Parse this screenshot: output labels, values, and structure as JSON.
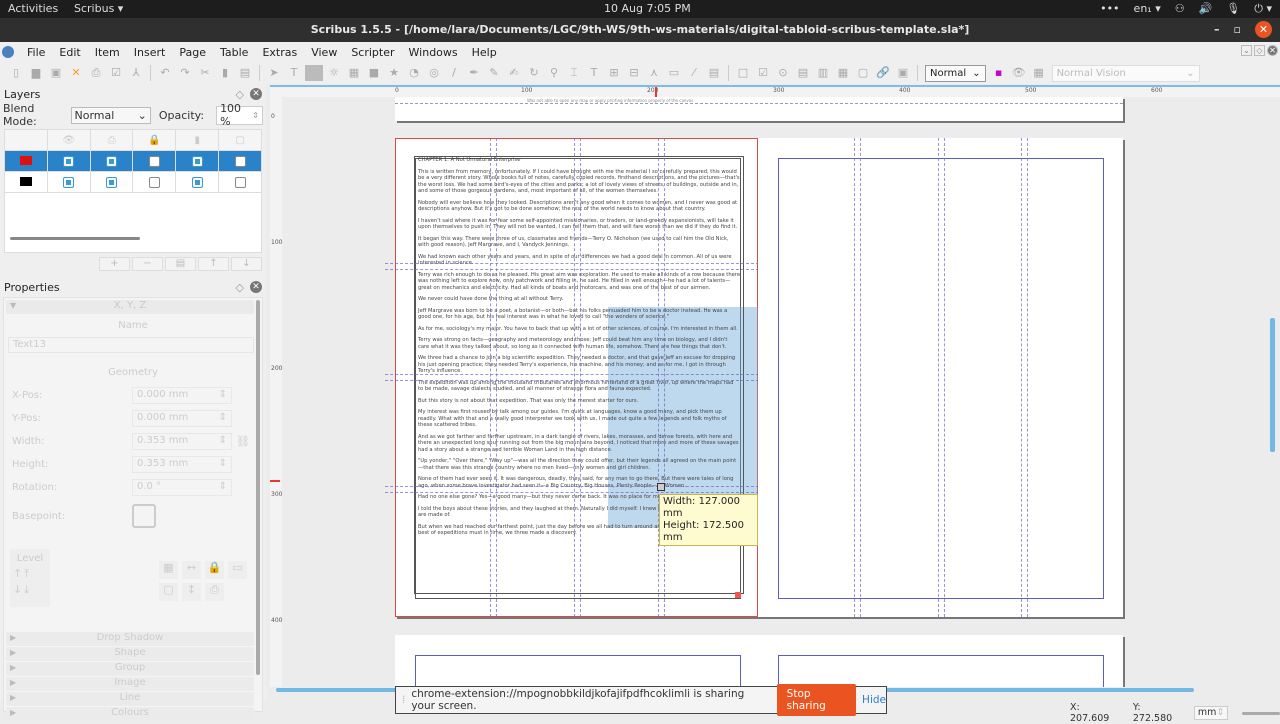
{
  "system_bar": {
    "activities": "Activities",
    "app_menu": "Scribus ▾",
    "clock": "10 Aug  7:05 PM",
    "tray": [
      "•••",
      "en₁ ▾",
      "⚇",
      "🔊",
      "🎙",
      "⏻ ▾"
    ]
  },
  "window": {
    "title": "Scribus 1.5.5 - [/home/lara/Documents/LGC/9th-WS/9th-ws-materials/digital-tabloid-scribus-template.sla*]",
    "minimize": "–",
    "restore": "▫",
    "close": "✕"
  },
  "menu": [
    "File",
    "Edit",
    "Item",
    "Insert",
    "Page",
    "Table",
    "Extras",
    "View",
    "Scripter",
    "Windows",
    "Help"
  ],
  "toolbar": {
    "preview_mode": "Normal",
    "vision_mode": "Normal Vision"
  },
  "layers_panel": {
    "title": "Layers",
    "blend_label": "Blend Mode:",
    "blend_value": "Normal",
    "opacity_label": "Opacity:",
    "opacity_value": "100 %",
    "columns": [
      "color",
      "visible",
      "printable",
      "locked",
      "flow",
      "outline"
    ],
    "rows": [
      {
        "color": "#e01010",
        "visible": true,
        "printable": true,
        "locked": false,
        "flow": true,
        "outline": false,
        "selected": true
      },
      {
        "color": "#000000",
        "visible": true,
        "printable": true,
        "locked": false,
        "flow": true,
        "outline": false,
        "selected": false
      }
    ],
    "buttons": [
      "+",
      "−",
      "▤",
      "↑",
      "↓"
    ]
  },
  "properties_panel": {
    "title": "Properties",
    "section_xyz": "X, Y, Z",
    "name_label": "Name",
    "name_value": "Text13",
    "geometry_label": "Geometry",
    "fields": [
      {
        "label": "X-Pos:",
        "value": "0.000 mm"
      },
      {
        "label": "Y-Pos:",
        "value": "0.000 mm"
      },
      {
        "label": "Width:",
        "value": "0.353 mm"
      },
      {
        "label": "Height:",
        "value": "0.353 mm"
      },
      {
        "label": "Rotation:",
        "value": "0.0 °"
      }
    ],
    "basepoint_label": "Basepoint:",
    "level_label": "Level",
    "collapsed_sections": [
      "Drop Shadow",
      "Shape",
      "Group",
      "Image",
      "Line",
      "Colours"
    ]
  },
  "ruler": {
    "h_ticks": [
      "0",
      "100",
      "200",
      "300",
      "400",
      "500",
      "600"
    ],
    "v_ticks": [
      "0",
      "100",
      "200",
      "300",
      "400"
    ]
  },
  "document": {
    "chapter": "CHAPTER 1. A Not Unnatural Enterprise",
    "paragraphs": [
      "This is written from memory, unfortunately. If I could have brought with me the material I so carefully prepared, this would be a very different story. Whole books full of notes, carefully copied records, firsthand descriptions, and the pictures—that's the worst loss. We had some bird's-eyes of the cities and parks; a lot of lovely views of streets, of buildings, outside and in, and some of those gorgeous gardens, and, most important of all, of the women themselves.",
      "Nobody will ever believe how they looked. Descriptions aren't any good when it comes to women, and I never was good at descriptions anyhow. But it's got to be done somehow; the rest of the world needs to know about that country.",
      "I haven't said where it was for fear some self-appointed missionaries, or traders, or land-greedy expansionists, will take it upon themselves to push in. They will not be wanted, I can tell them that, and will fare worse than we did if they do find it.",
      "It began this way. There were three of us, classmates and friends—Terry O. Nicholson (we used to call him the Old Nick, with good reason), Jeff Margrave, and I, Vandyck Jennings.",
      "We had known each other years and years, and in spite of our differences we had a good deal in common. All of us were interested in science.",
      "Terry was rich enough to do as he pleased. His great aim was exploration. He used to make all kinds of a row because there was nothing left to explore now, only patchwork and filling in, he said. He filled in well enough—he had a lot of talents—great on mechanics and electricity. Had all kinds of boats and motorcars, and was one of the best of our airmen.",
      "We never could have done the thing at all without Terry.",
      "Jeff Margrave was born to be a poet, a botanist—or both—but his folks persuaded him to be a doctor instead. He was a good one, for his age, but his real interest was in what he loved to call \"the wonders of science.\"",
      "As for me, sociology's my major. You have to back that up with a lot of other sciences, of course. I'm interested in them all.",
      "Terry was strong on facts—geography and meteorology and those; Jeff could beat him any time on biology, and I didn't care what it was they talked about, so long as it connected with human life, somehow. There are few things that don't.",
      "We three had a chance to join a big scientific expedition. They needed a doctor, and that gave Jeff an excuse for dropping his just opening practice; they needed Terry's experience, his machine, and his money; and as for me, I got in through Terry's influence.",
      "The expedition was up among the thousand tributaries and enormous hinterland of a great river, up where the maps had to be made, savage dialects studied, and all manner of strange flora and fauna expected.",
      "But this story is not about that expedition. That was only the merest starter for ours.",
      "My interest was first roused by talk among our guides. I'm quick at languages, know a good many, and pick them up readily. What with that and a really good interpreter we took with us, I made out quite a few legends and folk myths of these scattered tribes.",
      "And as we got farther and farther upstream, in a dark tangle of rivers, lakes, morasses, and dense forests, with here and there an unexpected long spur running out from the big mountains beyond, I noticed that more and more of these savages had a story about a strange and terrible Woman Land in the high distance.",
      "\"Up yonder,\" \"Over there,\" \"Way up\"—was all the direction they could offer, but their legends all agreed on the main point—that there was this strange country where no men lived—only women and girl children.",
      "None of them had ever seen it. It was dangerous, deadly, they said, for any man to go there. But there were tales of long ago, when some brave investigator had seen it—a Big Country, Big Houses, Plenty People—All Women.",
      "Had no one else gone? Yes—a good many—but they never came back. It was no place for men—of that they seemed sure.",
      "I told the boys about these stories, and they laughed at them. Naturally I did myself. I knew the stuff that savage dreams are made of.",
      "But when we had reached our farthest point, just the day before we all had to turn around and start for home again, as the best of expeditions must in time, we three made a discovery."
    ],
    "top_strip_text": "Was not able to open any map or apply printing information properly of the canvas"
  },
  "tooltip": {
    "width": "Width: 127.000 mm",
    "height": "Height: 172.500 mm"
  },
  "share_bar": {
    "message": "chrome-extension://mpognobbkildjkofajifpdfhcoklimli is sharing your screen.",
    "stop_label": "Stop sharing",
    "hide_label": "Hide"
  },
  "status_bar": {
    "x": "X: 207.609",
    "y": "Y: 272.580",
    "unit": "mm"
  }
}
